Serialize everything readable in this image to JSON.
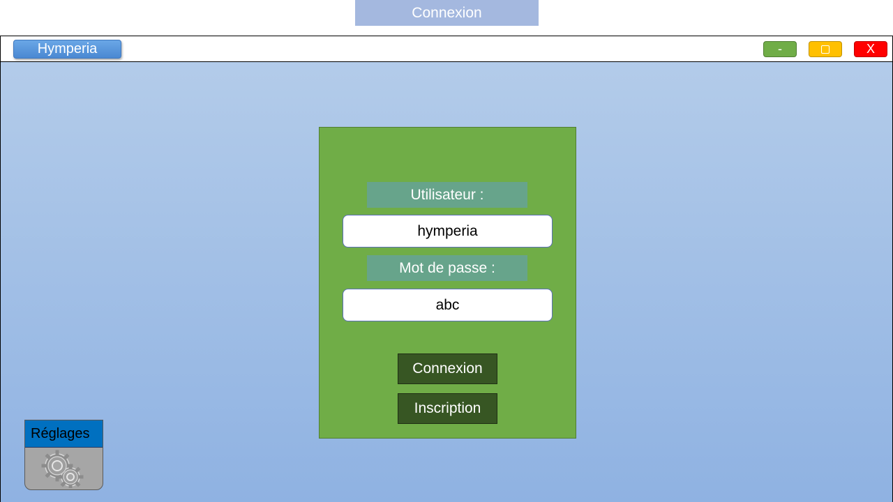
{
  "page": {
    "header_title": "Connexion"
  },
  "window": {
    "app_title": "Hymperia",
    "controls": {
      "minimize_label": "-",
      "close_label": "X"
    }
  },
  "login": {
    "user_label": "Utilisateur :",
    "user_value": "hymperia",
    "password_label": "Mot de passe :",
    "password_value": "abc",
    "login_button": "Connexion",
    "register_button": "Inscription"
  },
  "settings": {
    "label": "Réglages",
    "icon": "gear-icon"
  },
  "colors": {
    "header_bg": "#a4b8df",
    "panel_bg": "#70ad47",
    "label_bg": "#67a48b",
    "button_bg": "#375623",
    "minimize": "#70ad47",
    "maximize": "#ffc000",
    "close": "#ff0000",
    "settings_head": "#0070c0"
  }
}
